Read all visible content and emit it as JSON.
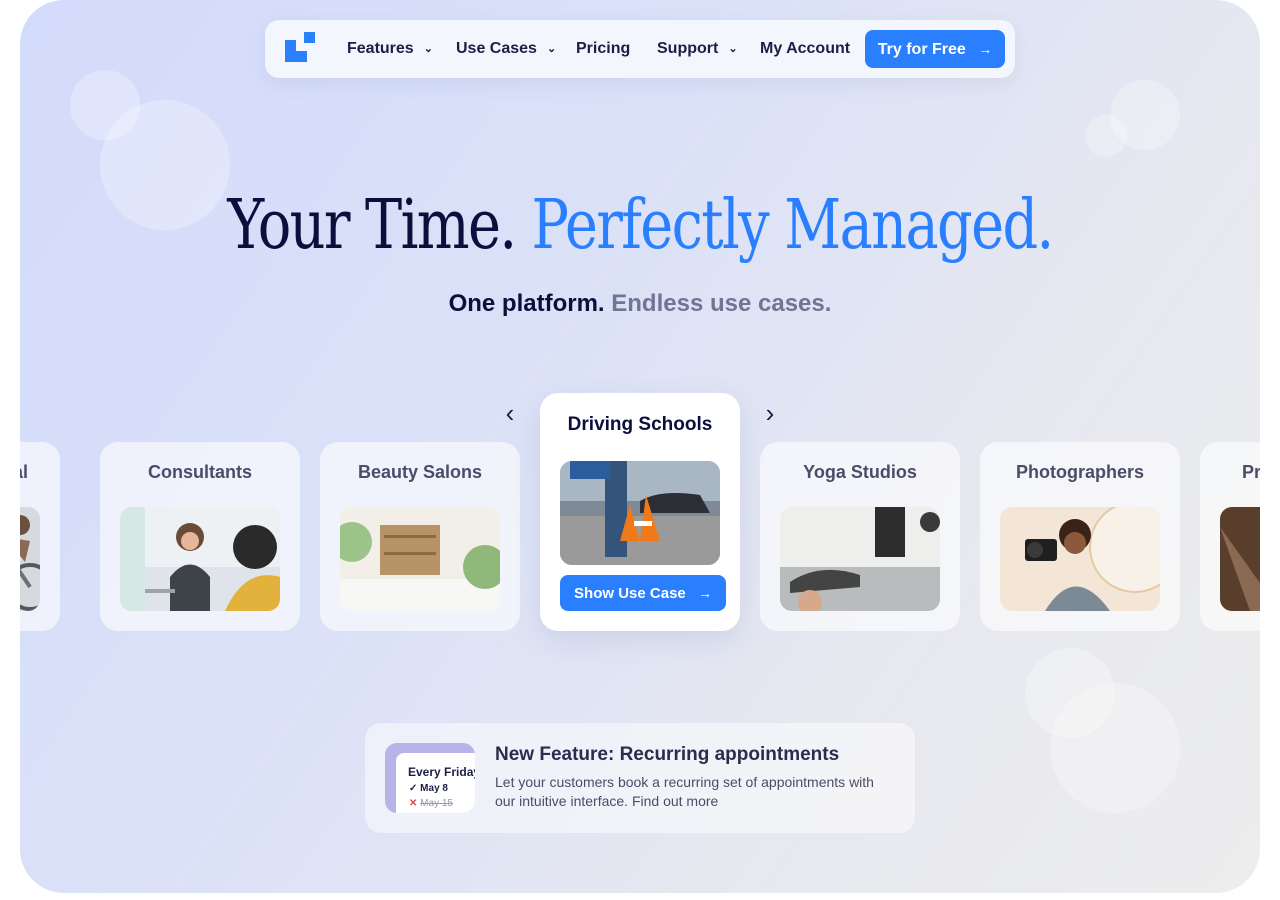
{
  "colors": {
    "accent": "#2a7fff",
    "navy": "#0c0e3c",
    "muted": "#707495"
  },
  "nav": {
    "logo_icon": "brand-logo-icon",
    "items": [
      {
        "label": "Features",
        "has_dropdown": true
      },
      {
        "label": "Use Cases",
        "has_dropdown": true
      },
      {
        "label": "Pricing",
        "has_dropdown": false
      },
      {
        "label": "Support",
        "has_dropdown": true
      },
      {
        "label": "My Account",
        "has_dropdown": false
      }
    ],
    "cta_label": "Try for Free",
    "cta_icon": "arrow-right-icon"
  },
  "hero": {
    "title_part1": "Your Time.",
    "title_part2": "Perfectly Managed.",
    "subtitle_part1": "One platform.",
    "subtitle_part2": "Endless use cases."
  },
  "carousel": {
    "prev_icon": "chevron-left-icon",
    "next_icon": "chevron-right-icon",
    "cards": [
      {
        "label": "ntal"
      },
      {
        "label": "Consultants"
      },
      {
        "label": "Beauty Salons"
      },
      {
        "label": "Driving Schools",
        "active": true,
        "button_label": "Show Use Case"
      },
      {
        "label": "Yoga Studios"
      },
      {
        "label": "Photographers"
      },
      {
        "label": "Priva"
      }
    ]
  },
  "feature": {
    "thumb": {
      "title": "Every Friday",
      "row1": "May 8",
      "row2": "May 15"
    },
    "title": "New Feature: Recurring appointments",
    "text": "Let your customers book a recurring set of appointments with our intuitive interface. Find out more"
  }
}
